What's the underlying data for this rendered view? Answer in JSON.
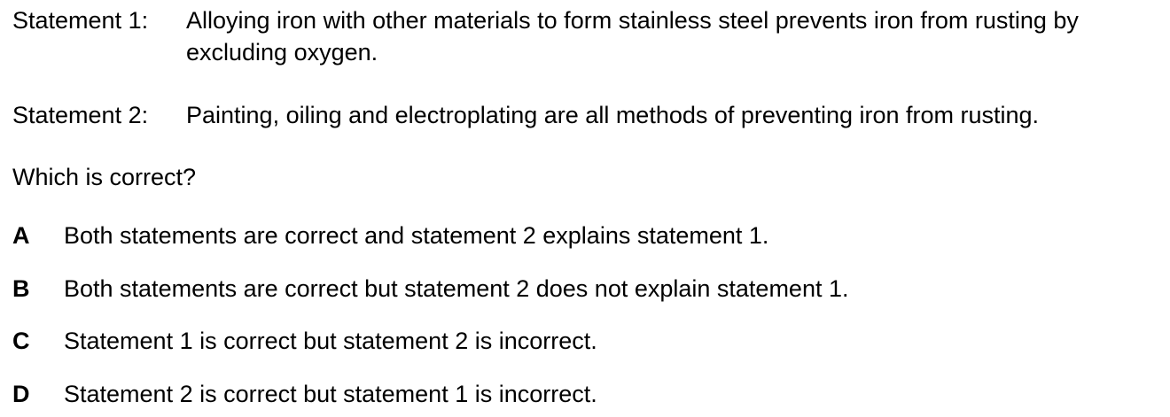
{
  "statements": [
    {
      "label": "Statement 1:",
      "text": "Alloying iron with other materials to form stainless steel prevents iron from rusting by excluding oxygen."
    },
    {
      "label": "Statement 2:",
      "text": "Painting, oiling and electroplating are all methods of preventing iron from rusting."
    }
  ],
  "question": "Which is correct?",
  "options": [
    {
      "letter": "A",
      "text": "Both statements are correct and statement 2 explains statement 1."
    },
    {
      "letter": "B",
      "text": "Both statements are correct but statement 2 does not explain statement 1."
    },
    {
      "letter": "C",
      "text": "Statement 1 is correct but statement 2 is incorrect."
    },
    {
      "letter": "D",
      "text": "Statement 2 is correct but statement 1 is incorrect."
    }
  ]
}
